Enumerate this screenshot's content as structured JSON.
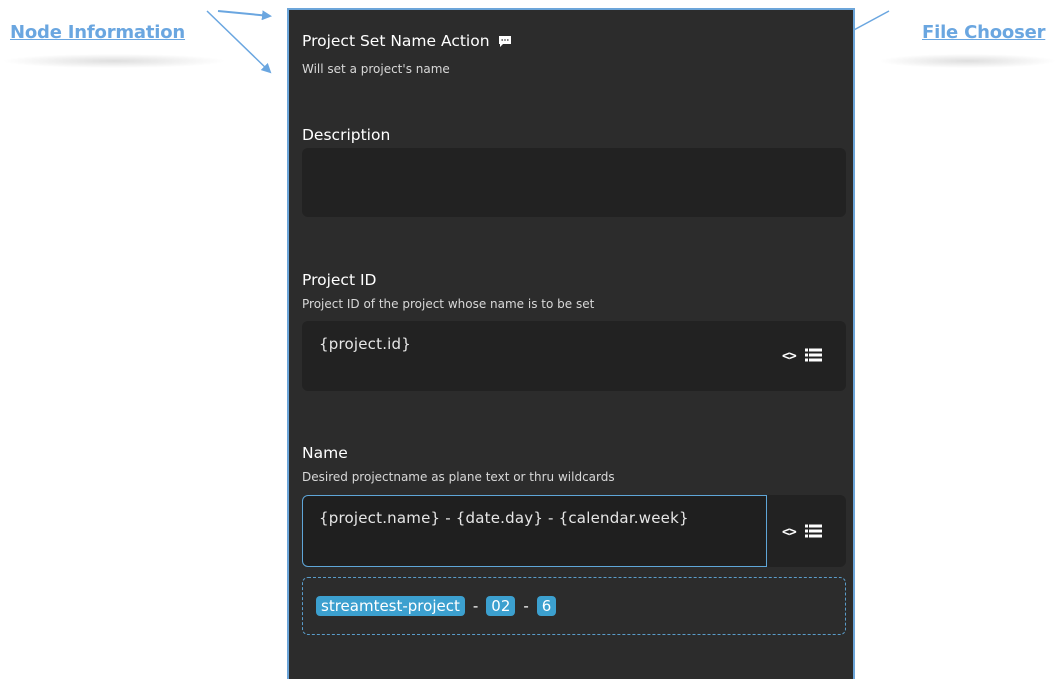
{
  "annotations": {
    "node_information": "Node Information",
    "file_chooser": "File Chooser"
  },
  "panel": {
    "title": "Project Set Name Action",
    "subtitle": "Will set a project's name",
    "description": {
      "label": "Description",
      "value": ""
    },
    "project_id": {
      "label": "Project ID",
      "help": "Project ID of the project whose name is to be set",
      "value": "{project.id}",
      "code_icon": "<>"
    },
    "name": {
      "label": "Name",
      "help": "Desired projectname as plane text or thru wildcards",
      "value": "{project.name} - {date.day} - {calendar.week}",
      "code_icon": "<>"
    },
    "preview": {
      "chips": [
        "streamtest-project",
        "02",
        "6"
      ],
      "separator": "-"
    }
  },
  "colors": {
    "annotation": "#6aa6e0",
    "panel_bg": "#2c2c2c",
    "input_bg": "#222222",
    "accent": "#3ca0cf",
    "focus_border": "#5fa6d8"
  }
}
